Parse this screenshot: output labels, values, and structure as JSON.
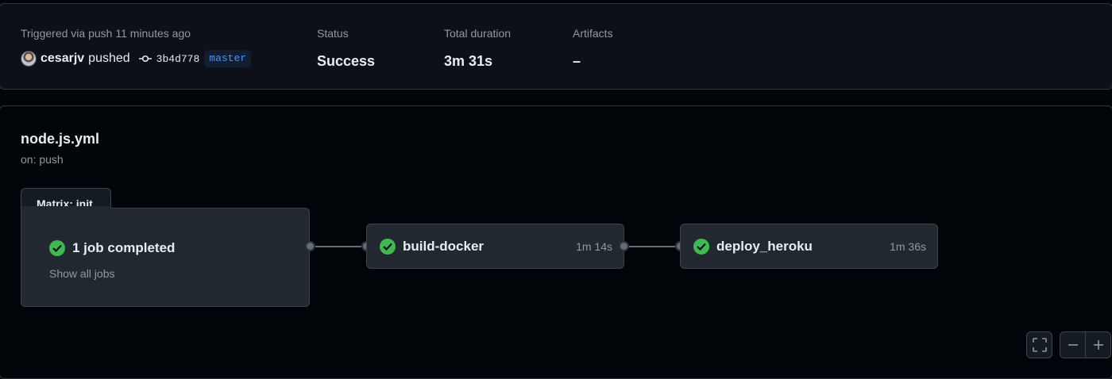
{
  "run_summary": {
    "trigger_label": "Triggered via push 11 minutes ago",
    "actor": "cesarjv",
    "action": "pushed",
    "commit_sha": "3b4d778",
    "branch": "master",
    "status_label": "Status",
    "status_value": "Success",
    "duration_label": "Total duration",
    "duration_value": "3m 31s",
    "artifacts_label": "Artifacts",
    "artifacts_value": "–"
  },
  "workflow": {
    "file_name": "node.js.yml",
    "trigger": "on: push",
    "matrix": {
      "tab_label": "Matrix: init",
      "status_text": "1 job completed",
      "show_all_label": "Show all jobs"
    },
    "jobs": [
      {
        "name": "build-docker",
        "duration": "1m 14s",
        "status": "success"
      },
      {
        "name": "deploy_heroku",
        "duration": "1m 36s",
        "status": "success"
      }
    ]
  },
  "controls": {
    "fullscreen_icon": "fullscreen-icon",
    "zoom_out_icon": "zoom-out-icon",
    "zoom_in_icon": "zoom-in-icon"
  },
  "colors": {
    "success": "#3fb950",
    "branch": "#4493f8",
    "background": "#010409"
  }
}
